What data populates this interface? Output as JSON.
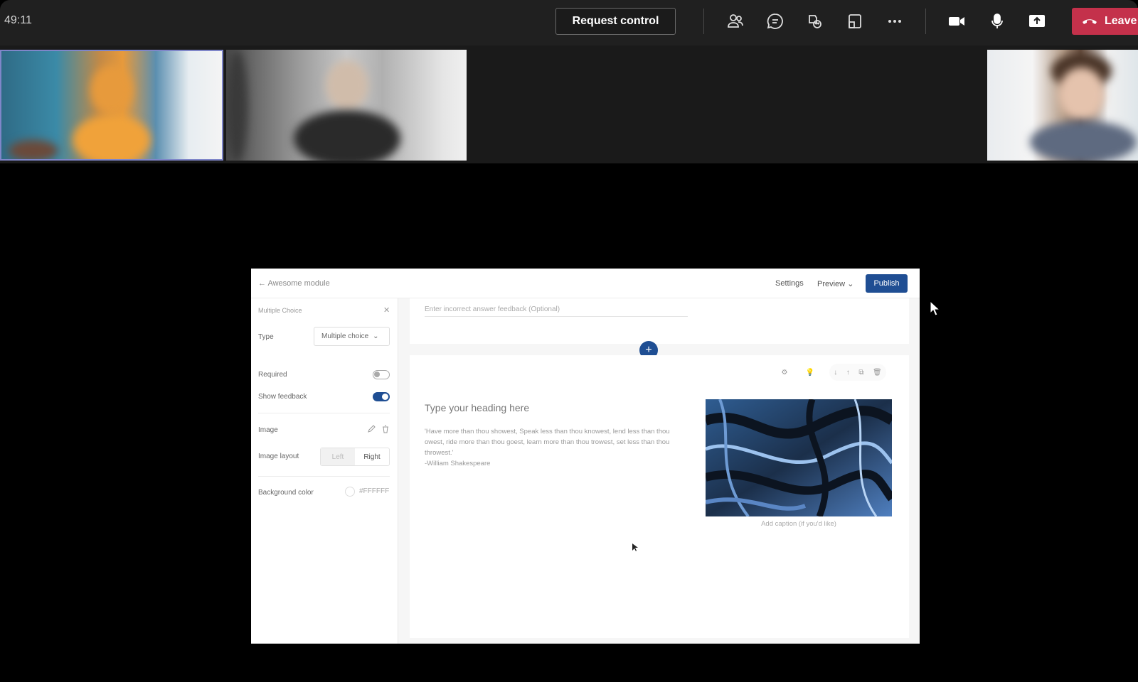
{
  "meeting": {
    "timer": "49:11",
    "request_control_label": "Request control",
    "leave_label": "Leave",
    "toolbar_icons": [
      "people-icon",
      "chat-icon",
      "reactions-icon",
      "view-icon",
      "more-icon",
      "camera-icon",
      "mic-icon",
      "share-icon"
    ]
  },
  "shared_app": {
    "back_label": "Awesome module",
    "settings_label": "Settings",
    "preview_label": "Preview",
    "publish_label": "Publish",
    "panel": {
      "title": "Multiple Choice",
      "type_label": "Type",
      "type_value": "Multiple choice",
      "required_label": "Required",
      "required_on": false,
      "show_feedback_label": "Show feedback",
      "show_feedback_on": true,
      "image_label": "Image",
      "image_layout_label": "Image layout",
      "layout_left": "Left",
      "layout_right": "Right",
      "background_color_label": "Background color",
      "background_color_value": "#FFFFFF"
    },
    "content": {
      "feedback_placeholder": "Enter incorrect answer feedback (Optional)",
      "heading_placeholder": "Type your heading here",
      "quote": "'Have more than thou showest, Speak less than thou knowest, lend less than thou owest, ride more than thou goest, learn more than thou trowest, set less than thou throwest.'",
      "quote_author": "-William Shakespeare",
      "caption_placeholder": "Add caption (if you'd like)"
    }
  },
  "colors": {
    "leave": "#c4314b",
    "publish": "#1f4e93",
    "topbar": "#202020"
  }
}
